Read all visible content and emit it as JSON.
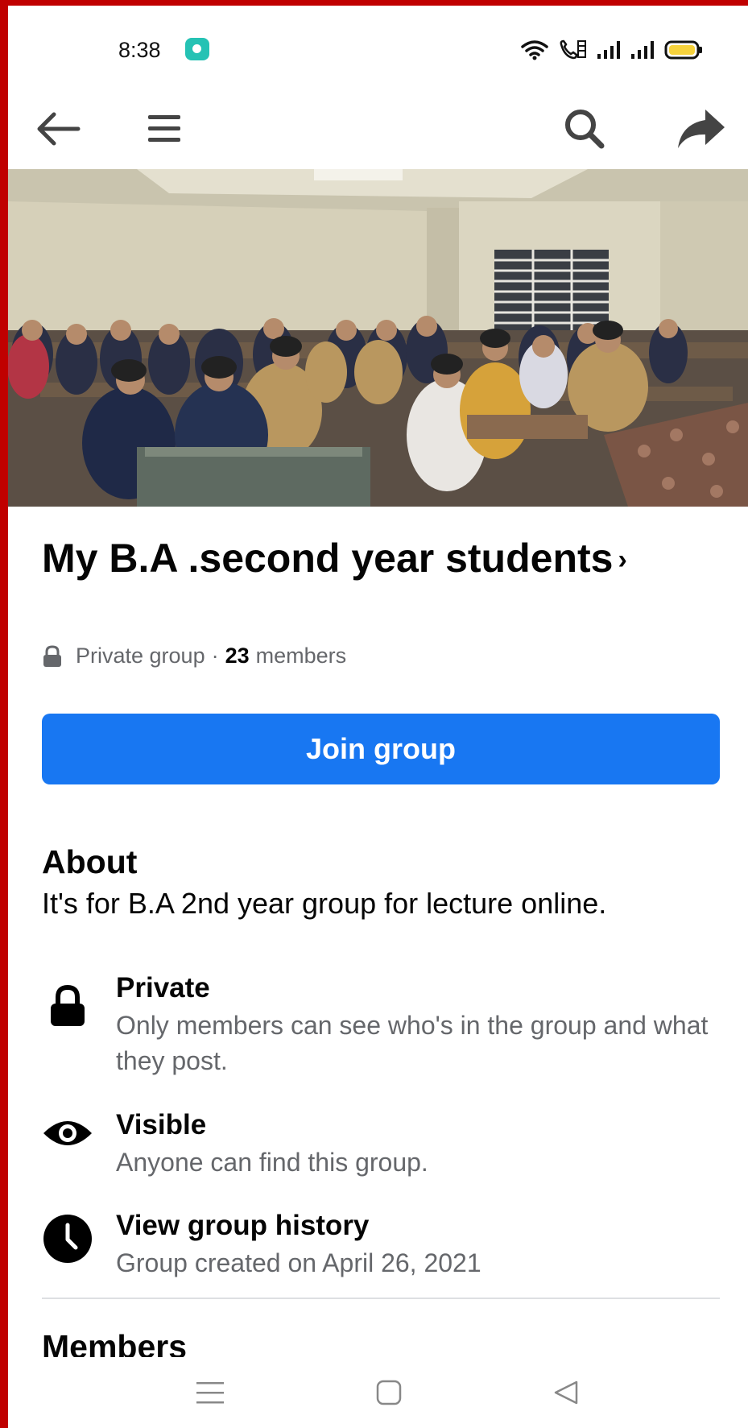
{
  "status_bar": {
    "time": "8:38",
    "icons": [
      "chat-bubble-icon",
      "wifi-icon",
      "volte-call-icon",
      "signal-icon",
      "signal-icon",
      "battery-icon"
    ]
  },
  "nav": {
    "icons": [
      "back-arrow-icon",
      "menu-icon",
      "search-icon",
      "share-icon"
    ]
  },
  "group": {
    "title": "My B.A .second year students",
    "chevron": "›",
    "privacy": "Private group",
    "separator": "·",
    "member_count": "23",
    "members_label": "members"
  },
  "join_label": "Join group",
  "about": {
    "heading": "About",
    "description": "It's for B.A 2nd year group for lecture online.",
    "items": [
      {
        "icon": "lock-icon",
        "title": "Private",
        "subtitle": "Only members can see who's in the group and what they post."
      },
      {
        "icon": "eye-icon",
        "title": "Visible",
        "subtitle": "Anyone can find this group."
      },
      {
        "icon": "clock-icon",
        "title": "View group history",
        "subtitle": "Group created on April 26, 2021"
      }
    ]
  },
  "members_heading": "Members",
  "system_nav": {
    "icons": [
      "recents-icon",
      "home-icon",
      "back-icon"
    ]
  },
  "colors": {
    "accent": "#1877f2",
    "secondary_text": "#65676b",
    "frame": "#c00000"
  }
}
